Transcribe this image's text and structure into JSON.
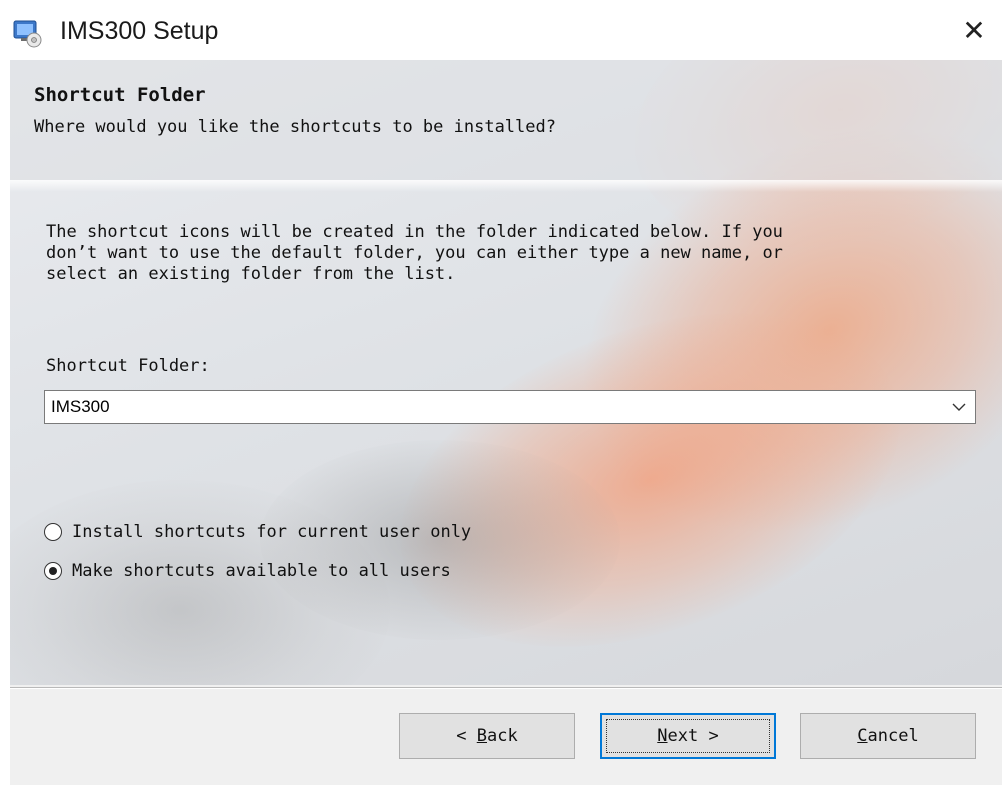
{
  "window": {
    "title": "IMS300 Setup",
    "close_label": "✕"
  },
  "header": {
    "title": "Shortcut Folder",
    "subtitle": "Where would you like the shortcuts to be installed?"
  },
  "body": {
    "description": "The shortcut icons will be created in the folder indicated below. If you\ndon’t want to use the default folder, you can either type a new name, or\nselect an existing folder from the list.",
    "folder_label": "Shortcut Folder:",
    "folder_value": "IMS300"
  },
  "options": [
    {
      "label": "Install shortcuts for current user only",
      "selected": false
    },
    {
      "label": "Make shortcuts available to all users",
      "selected": true
    }
  ],
  "buttons": {
    "back": {
      "prefix": "< ",
      "mnemonic": "B",
      "rest": "ack"
    },
    "next": {
      "mnemonic": "N",
      "rest": "ext >"
    },
    "cancel": {
      "mnemonic": "C",
      "rest": "ancel"
    }
  },
  "icons": {
    "app": "installer-app-icon",
    "dropdown": "chevron-down-icon"
  },
  "colors": {
    "default_button_border": "#0078d7",
    "button_face": "#e1e1e1"
  }
}
